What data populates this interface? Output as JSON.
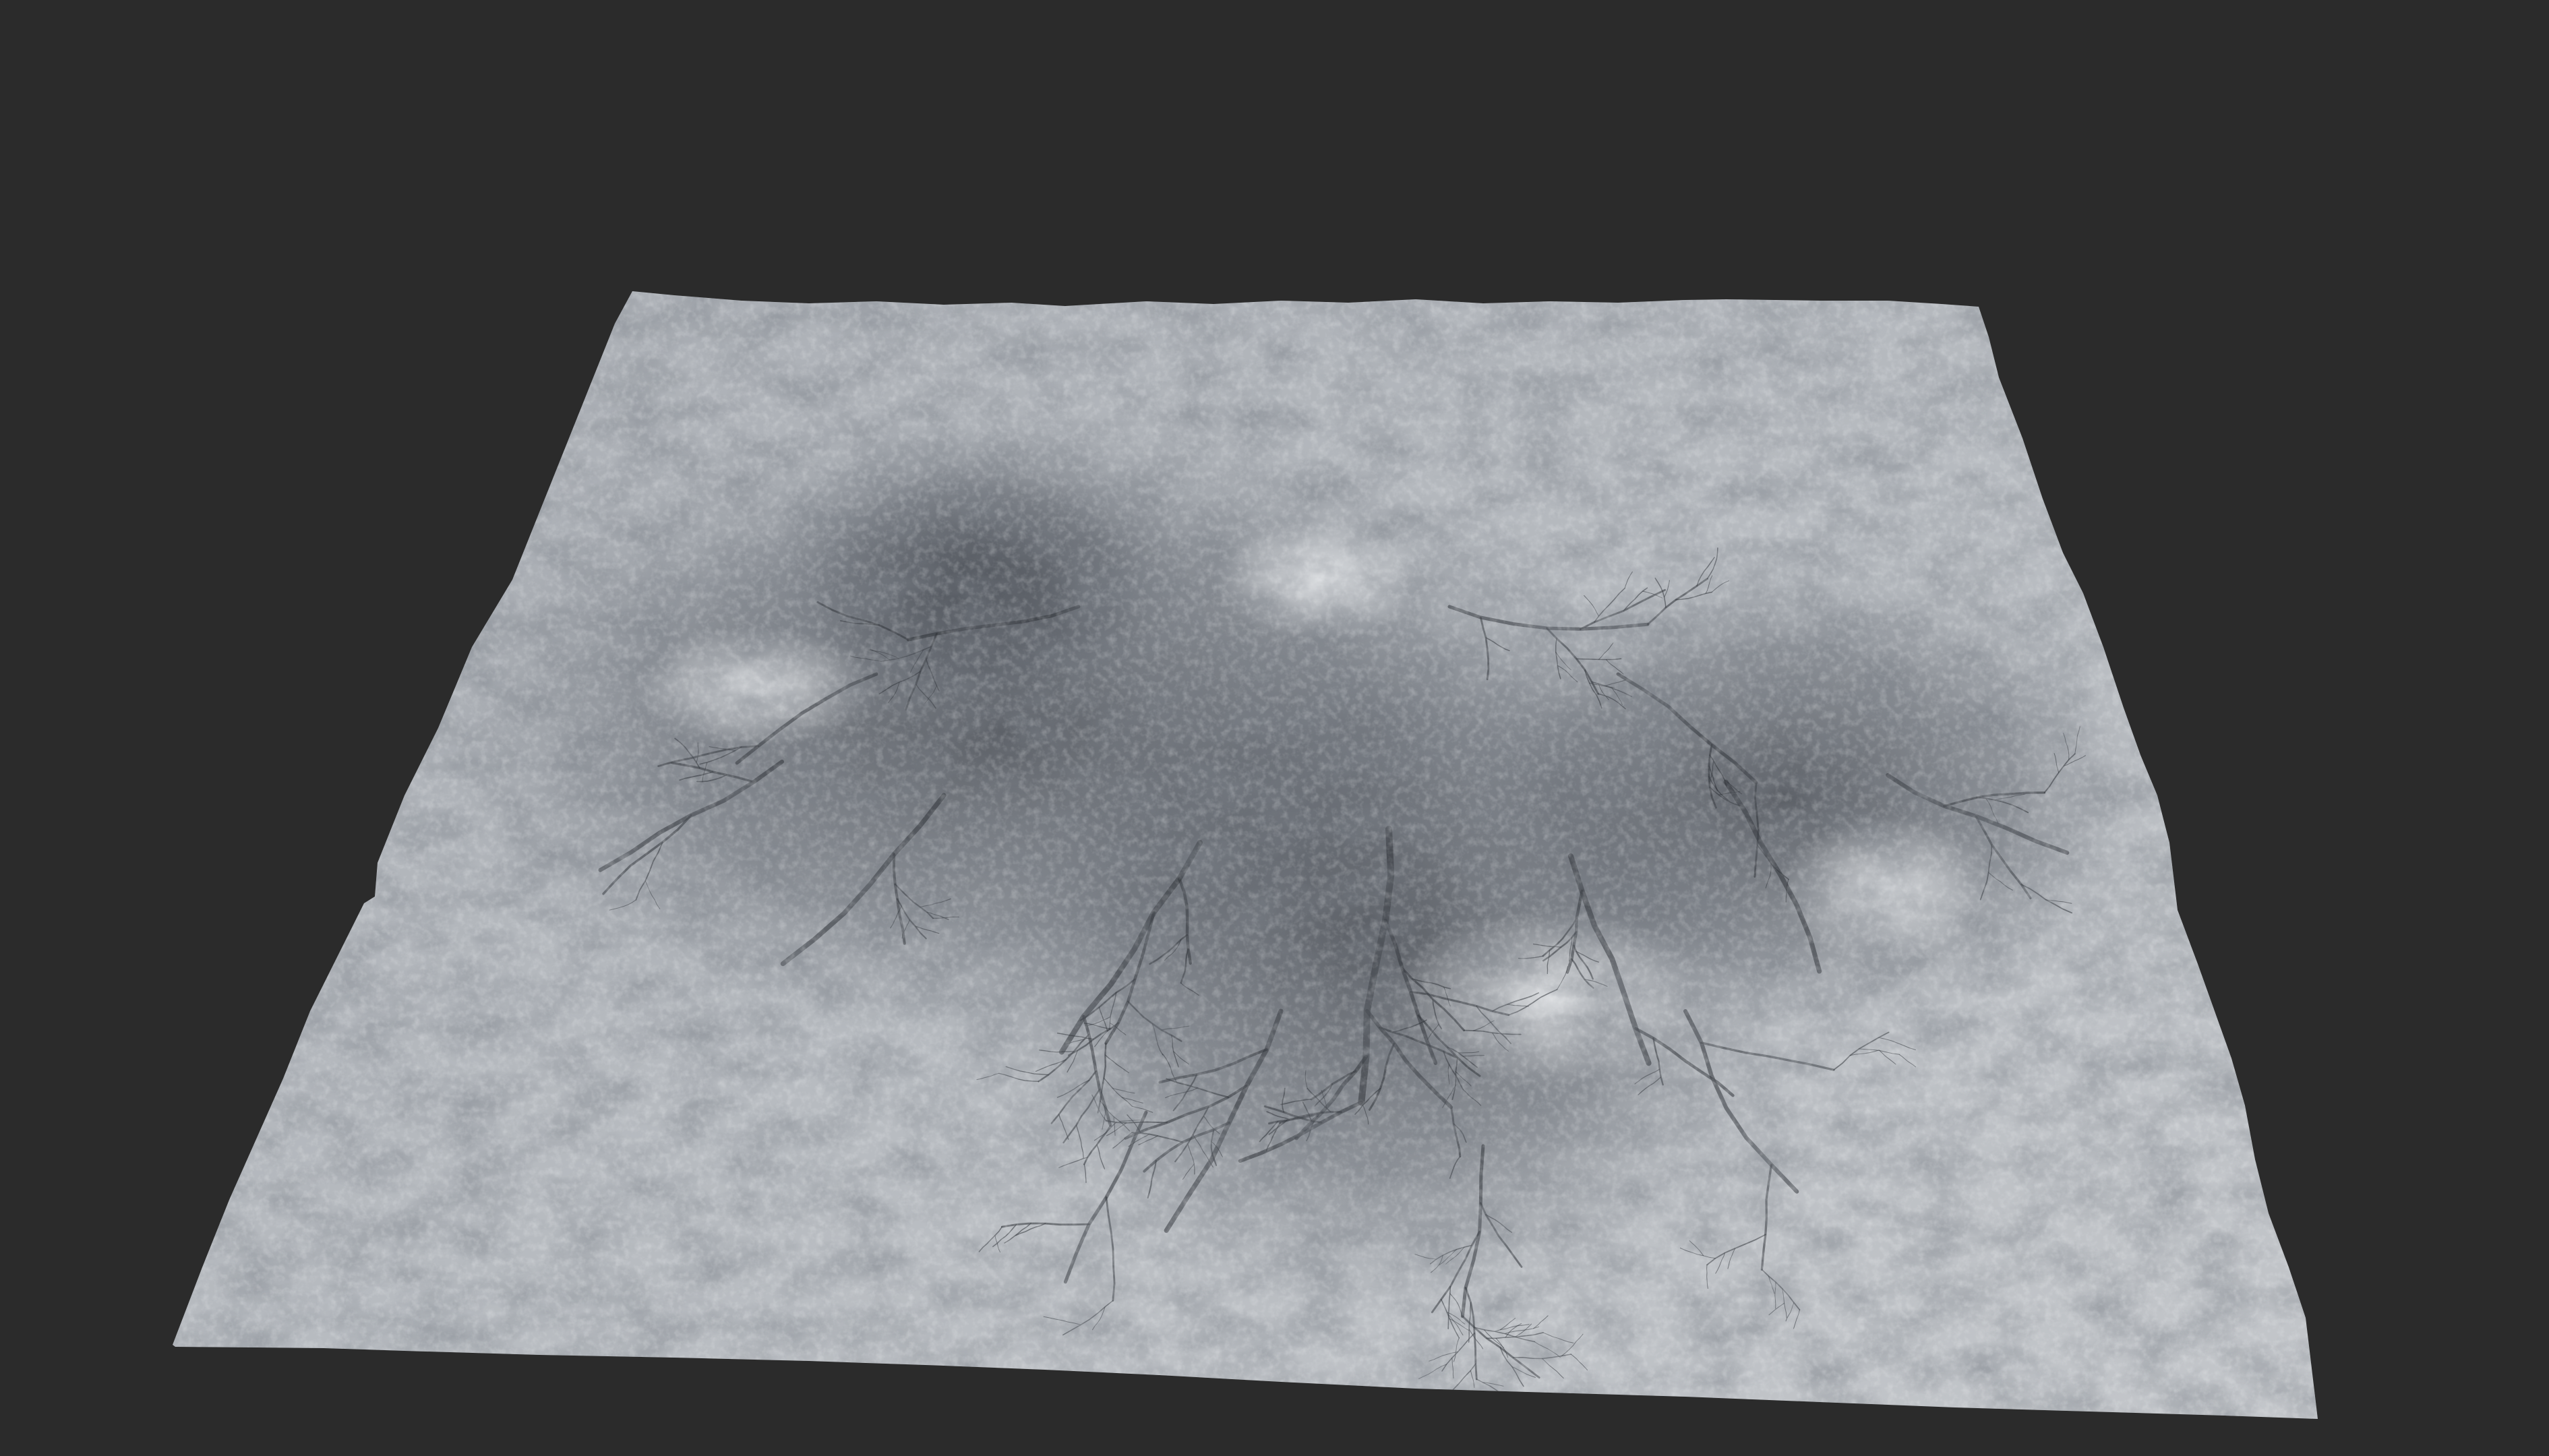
{
  "scene": {
    "background_color": "#2b2b2b",
    "subject": "terrain-mesh",
    "terrain_base_color": "#b4b8bd",
    "terrain_highlight_color": "#e9ecef",
    "terrain_shadow_color": "#3c4047",
    "lighting_direction": "from-right"
  }
}
